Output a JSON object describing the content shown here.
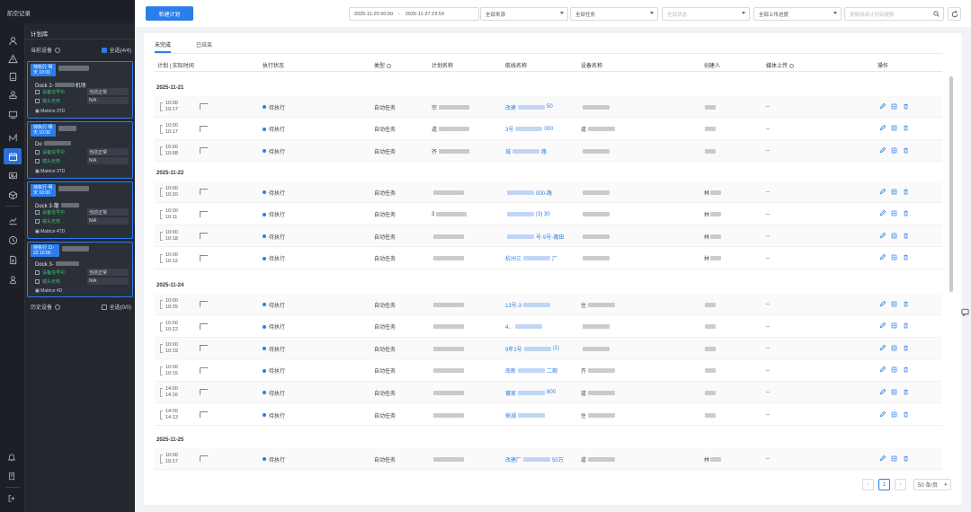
{
  "app": {
    "title": "航空记录"
  },
  "rail": {
    "icons": [
      "user-icon",
      "alert-icon",
      "device-icon",
      "person-icon",
      "dock-icon",
      "route-icon",
      "calendar-icon",
      "media-icon",
      "model-icon",
      "chart-icon",
      "history-icon",
      "doc-icon",
      "admin-icon"
    ],
    "bottom_icons": [
      "bell-icon",
      "note-icon",
      "logout-icon"
    ]
  },
  "panel": {
    "title": "计划库",
    "current_devices_label": "当前设备",
    "select_all_label": "全选(4/4)",
    "history_devices_label": "历史设备",
    "history_select_label": "全选(0/0)",
    "devices": [
      {
        "tag": "待执行 明天 10:00",
        "name": "Dock 2-",
        "name_suffix": "机场",
        "line1": "设备信号中",
        "line1_val": "当前正常",
        "line2": "镜头无热",
        "line2_val": "N/A",
        "model": "Matrice 3TD"
      },
      {
        "tag": "待执行 明天 10:00",
        "name": "Do",
        "name_suffix": "",
        "line1": "设备信号中",
        "line1_val": "当前正常",
        "line2": "镜头无热",
        "line2_val": "N/A",
        "model": "Matrice 3TD"
      },
      {
        "tag": "待执行 明天 10:00",
        "name": "Dock 3-莆",
        "name_suffix": "",
        "line1": "设备信号中",
        "line1_val": "当前正常",
        "line2": "镜头无热",
        "line2_val": "N/A",
        "model": "Matrice 4TD"
      },
      {
        "tag": "待执行 11-22 10:00",
        "name": "Dock 3-",
        "name_suffix": "",
        "line1": "设备信号中",
        "line1_val": "当前正常",
        "line2": "镜头无热",
        "line2_val": "N/A",
        "model": "Matrice 4D"
      }
    ]
  },
  "toolbar": {
    "new_plan_label": "新建计划",
    "date_start": "2025-11-20 00:00",
    "date_sep": "-",
    "date_end": "2025-11-27 23:59",
    "source_select": "全部来源",
    "task_select": "全部任务",
    "status_placeholder": "全部状态",
    "upload_select": "全部上传进度",
    "search_placeholder": "按航线或计划名搜索"
  },
  "tabs": [
    {
      "label": "未完成"
    },
    {
      "label": "已结束"
    }
  ],
  "table": {
    "headers": {
      "time": "计划 | 实际时间",
      "status": "执行状态",
      "type": "类型",
      "plan_name": "计划名称",
      "route_name": "航线名称",
      "device_name": "设备名称",
      "creator": "创建人",
      "media_upload": "媒体上传",
      "actions": "操作"
    },
    "status_text": "待执行",
    "type_text": "自动任务",
    "media_text": "--",
    "groups": [
      {
        "date": "2025-11-21",
        "rows": [
          {
            "t1": "10:00",
            "t2": "10:17",
            "plan": "宗",
            "route": "改建",
            "route_tail": "50",
            "device": "",
            "creator": ""
          },
          {
            "t1": "10:00",
            "t2": "10:17",
            "plan": "道",
            "route": "3号",
            "route_tail": "000",
            "device": "道",
            "creator": ""
          },
          {
            "t1": "10:00",
            "t2": "10:08",
            "plan": "齐",
            "route": "城",
            "route_tail": "路",
            "device": "",
            "creator": ""
          }
        ]
      },
      {
        "date": "2025-11-22",
        "rows": [
          {
            "t1": "10:00",
            "t2": "10:20",
            "plan": "",
            "route": "",
            "route_tail": "000-路",
            "device": "",
            "creator": "林"
          },
          {
            "t1": "10:00",
            "t2": "10:11",
            "plan": "3",
            "route": "",
            "route_tail": "(3) 30",
            "device": "",
            "creator": "林"
          },
          {
            "t1": "10:00",
            "t2": "10:18",
            "plan": "",
            "route": "",
            "route_tail": "号-5号-莆田",
            "device": "",
            "creator": "林"
          },
          {
            "t1": "10:00",
            "t2": "10:12",
            "plan": "",
            "route": "杭州三",
            "route_tail": "厂",
            "device": "",
            "creator": "林"
          }
        ]
      },
      {
        "date": "2025-11-24",
        "rows": [
          {
            "t1": "10:00",
            "t2": "10:25",
            "plan": "",
            "route": "13号-3",
            "route_tail": "",
            "device": "住",
            "creator": ""
          },
          {
            "t1": "10:00",
            "t2": "10:22",
            "plan": "",
            "route": "4、",
            "route_tail": "",
            "device": "",
            "creator": ""
          },
          {
            "t1": "10:00",
            "t2": "10:19",
            "plan": "",
            "route": "9年1号",
            "route_tail": "(1)",
            "device": "",
            "creator": ""
          },
          {
            "t1": "10:00",
            "t2": "10:15",
            "plan": "",
            "route": "南新",
            "route_tail": "二期",
            "device": "齐",
            "creator": ""
          },
          {
            "t1": "14:00",
            "t2": "14:16",
            "plan": "",
            "route": "莆家",
            "route_tail": "800",
            "device": "道",
            "creator": ""
          },
          {
            "t1": "14:00",
            "t2": "14:13",
            "plan": "",
            "route": "鼎湖",
            "route_tail": "",
            "device": "住",
            "creator": ""
          }
        ]
      },
      {
        "date": "2025-11-25",
        "rows": [
          {
            "t1": "10:00",
            "t2": "10:17",
            "plan": "",
            "route": "改建厂",
            "route_tail": "50万",
            "device": "道",
            "creator": "林"
          }
        ]
      }
    ]
  },
  "pagination": {
    "current": "1",
    "page_size": "50 条/页"
  }
}
